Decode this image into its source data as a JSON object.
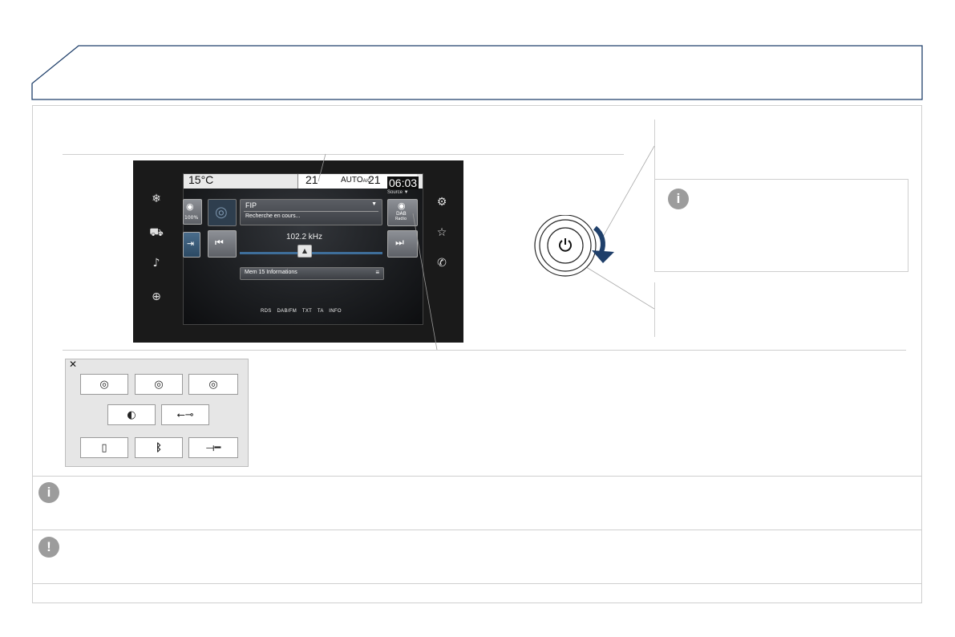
{
  "screen": {
    "temp_exterior": "15°C",
    "temp_left": "21",
    "ac_mode": "AUTO",
    "ac_suffix": "A/C",
    "temp_right": "21",
    "clock": "06:03",
    "source_label": "Source ▼",
    "volume_percent": "100%",
    "station_name": "FIP",
    "station_status": "Recherche en cours...",
    "dropdown_glyph": "▼",
    "band_button_line1": "DAB",
    "band_button_line2": "Radio",
    "frequency": "102.2 kHz",
    "memory_item": "Mem 15 Informations",
    "rds_bar": "RDS  DAB/FM  TXT  TA  INFO",
    "prev_glyph": "⏮",
    "next_glyph": "⏭",
    "slider_glyph": "▲",
    "slider_position": 0.45
  },
  "popup": {
    "close_glyph": "✕"
  },
  "notes": {
    "info_glyph": "i",
    "warning_glyph": "!"
  },
  "colors": {
    "header_stroke": "#1f3f6a",
    "arrow": "#1f3f6a",
    "badge": "#9c9c9c",
    "border": "#cfcfcf"
  }
}
